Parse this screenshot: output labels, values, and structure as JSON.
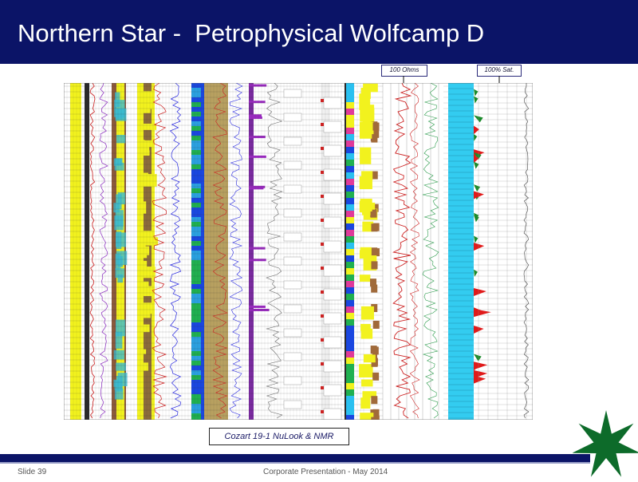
{
  "slide": {
    "title": "Northern Star -  Petrophysical Wolfcamp D",
    "callout_resistivity": "100 Ohms",
    "callout_saturation": "100% Sat.",
    "caption": "Cozart 19-1 NuLook & NMR",
    "footer_left": "Slide 39",
    "footer_center": "Corporate Presentation - May 2014"
  },
  "colors": {
    "header": "#0b1467",
    "logo_star": "#0d6b2a",
    "cyan_track": "#33ccf0",
    "porosity_yellow": "#f2f21e",
    "shale_brown": "#8b5a3c",
    "blue_track": "#1a47e0",
    "resistivity_red": "#cc2222"
  },
  "icons": {
    "logo": "green-star-logo-icon",
    "arrow": "down-arrow-icon"
  }
}
